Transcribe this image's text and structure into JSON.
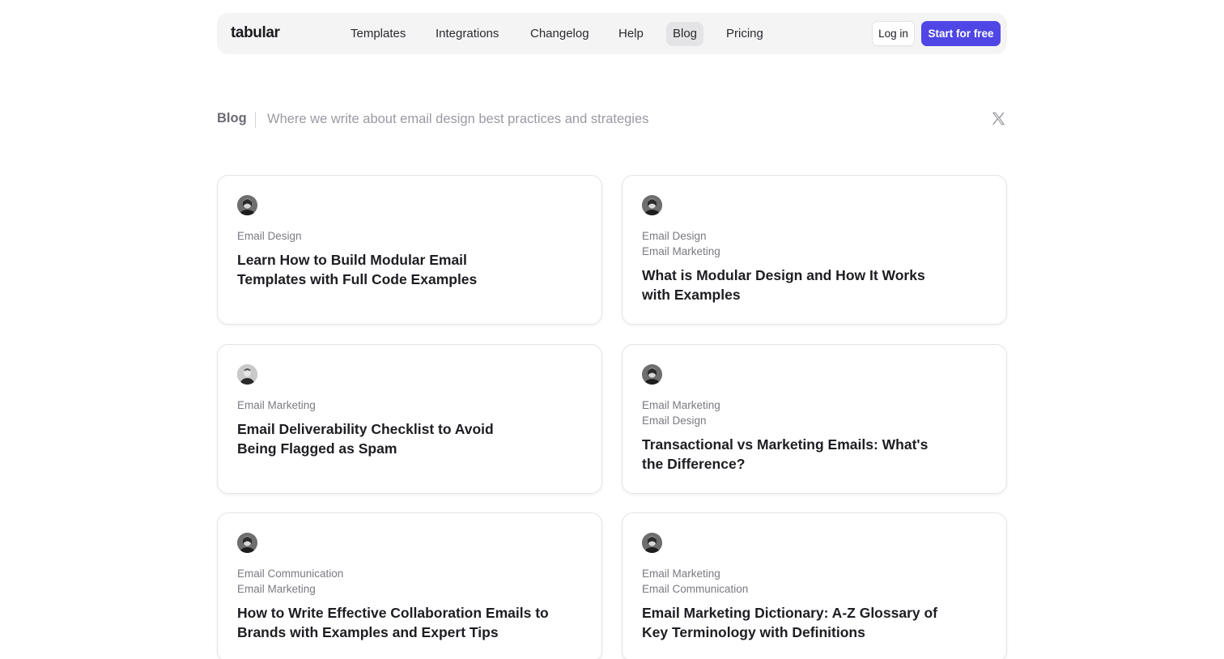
{
  "nav": {
    "logo": "tabular",
    "links": [
      {
        "label": "Templates",
        "active": false
      },
      {
        "label": "Integrations",
        "active": false
      },
      {
        "label": "Changelog",
        "active": false
      },
      {
        "label": "Help",
        "active": false
      },
      {
        "label": "Blog",
        "active": true
      },
      {
        "label": "Pricing",
        "active": false
      }
    ],
    "login_label": "Log in",
    "start_label": "Start for free",
    "accent_color": "#4f46e5"
  },
  "blog_header": {
    "title": "Blog",
    "tagline": "Where we write about email design best practices and strategies",
    "social_icon": "x-icon"
  },
  "posts": [
    {
      "tags": [
        "Email Design"
      ],
      "title": "Learn How to Build Modular Email Templates with Full Code Examples",
      "avatar_icon": "author-avatar"
    },
    {
      "tags": [
        "Email Design",
        "Email Marketing"
      ],
      "title": "What is Modular Design and How It Works with Examples",
      "avatar_icon": "author-avatar"
    },
    {
      "tags": [
        "Email Marketing"
      ],
      "title": "Email Deliverability Checklist to Avoid Being Flagged as Spam",
      "avatar_icon": "author-avatar"
    },
    {
      "tags": [
        "Email Marketing",
        "Email Design"
      ],
      "title": "Transactional vs Marketing Emails: What's the Difference?",
      "avatar_icon": "author-avatar"
    },
    {
      "tags": [
        "Email Communication",
        "Email Marketing"
      ],
      "title": "How to Write Effective Collaboration Emails to Brands with Examples and Expert Tips",
      "avatar_icon": "author-avatar"
    },
    {
      "tags": [
        "Email Marketing",
        "Email Communication"
      ],
      "title": "Email Marketing Dictionary: A-Z Glossary of Key Terminology with Definitions",
      "avatar_icon": "author-avatar"
    }
  ]
}
